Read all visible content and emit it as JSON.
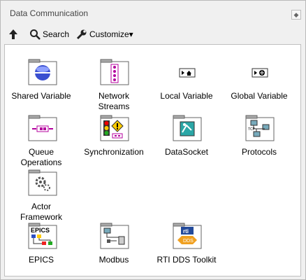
{
  "window": {
    "title": "Data Communication",
    "pin_label": "⊕"
  },
  "toolbar": {
    "up_label": "",
    "search_label": "Search",
    "customize_label": "Customize▾"
  },
  "palette": {
    "items": [
      {
        "label": "Shared Variable",
        "icon": "shared-variable-icon"
      },
      {
        "label": "Network\nStreams",
        "icon": "network-streams-icon"
      },
      {
        "label": "Local Variable",
        "icon": "local-variable-icon"
      },
      {
        "label": "Global Variable",
        "icon": "global-variable-icon"
      },
      {
        "label": "Queue\nOperations",
        "icon": "queue-operations-icon"
      },
      {
        "label": "Synchronization",
        "icon": "synchronization-icon"
      },
      {
        "label": "DataSocket",
        "icon": "datasocket-icon"
      },
      {
        "label": "Protocols",
        "icon": "protocols-icon"
      },
      {
        "label": "Actor\nFramework",
        "icon": "actor-framework-icon"
      },
      {
        "label": "EPICS",
        "icon": "epics-icon",
        "icon_text": "EPICS"
      },
      {
        "label": "Modbus",
        "icon": "modbus-icon"
      },
      {
        "label": "RTI DDS Toolkit",
        "icon": "rti-dds-icon",
        "icon_text": "rti",
        "icon_sub": "DDS"
      }
    ]
  },
  "colors": {
    "accent_blue": "#2d4fc1",
    "folder_gray": "#8a8a8a",
    "magenta": "#b4009e"
  }
}
